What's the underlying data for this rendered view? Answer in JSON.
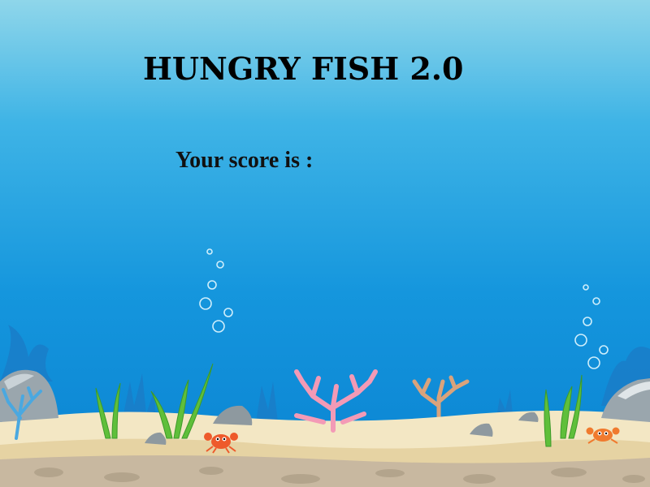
{
  "game": {
    "title": "HUNGRY FISH 2.0",
    "score_label": "Your score is :"
  },
  "colors": {
    "water_top": "#8fd6ea",
    "water_bottom": "#0a83d2",
    "sand": "#f3e7c4",
    "title_text": "#000000"
  },
  "icons": [
    "bubble-icon",
    "crab-icon",
    "rock-icon",
    "seaweed-icon",
    "coral-icon"
  ]
}
